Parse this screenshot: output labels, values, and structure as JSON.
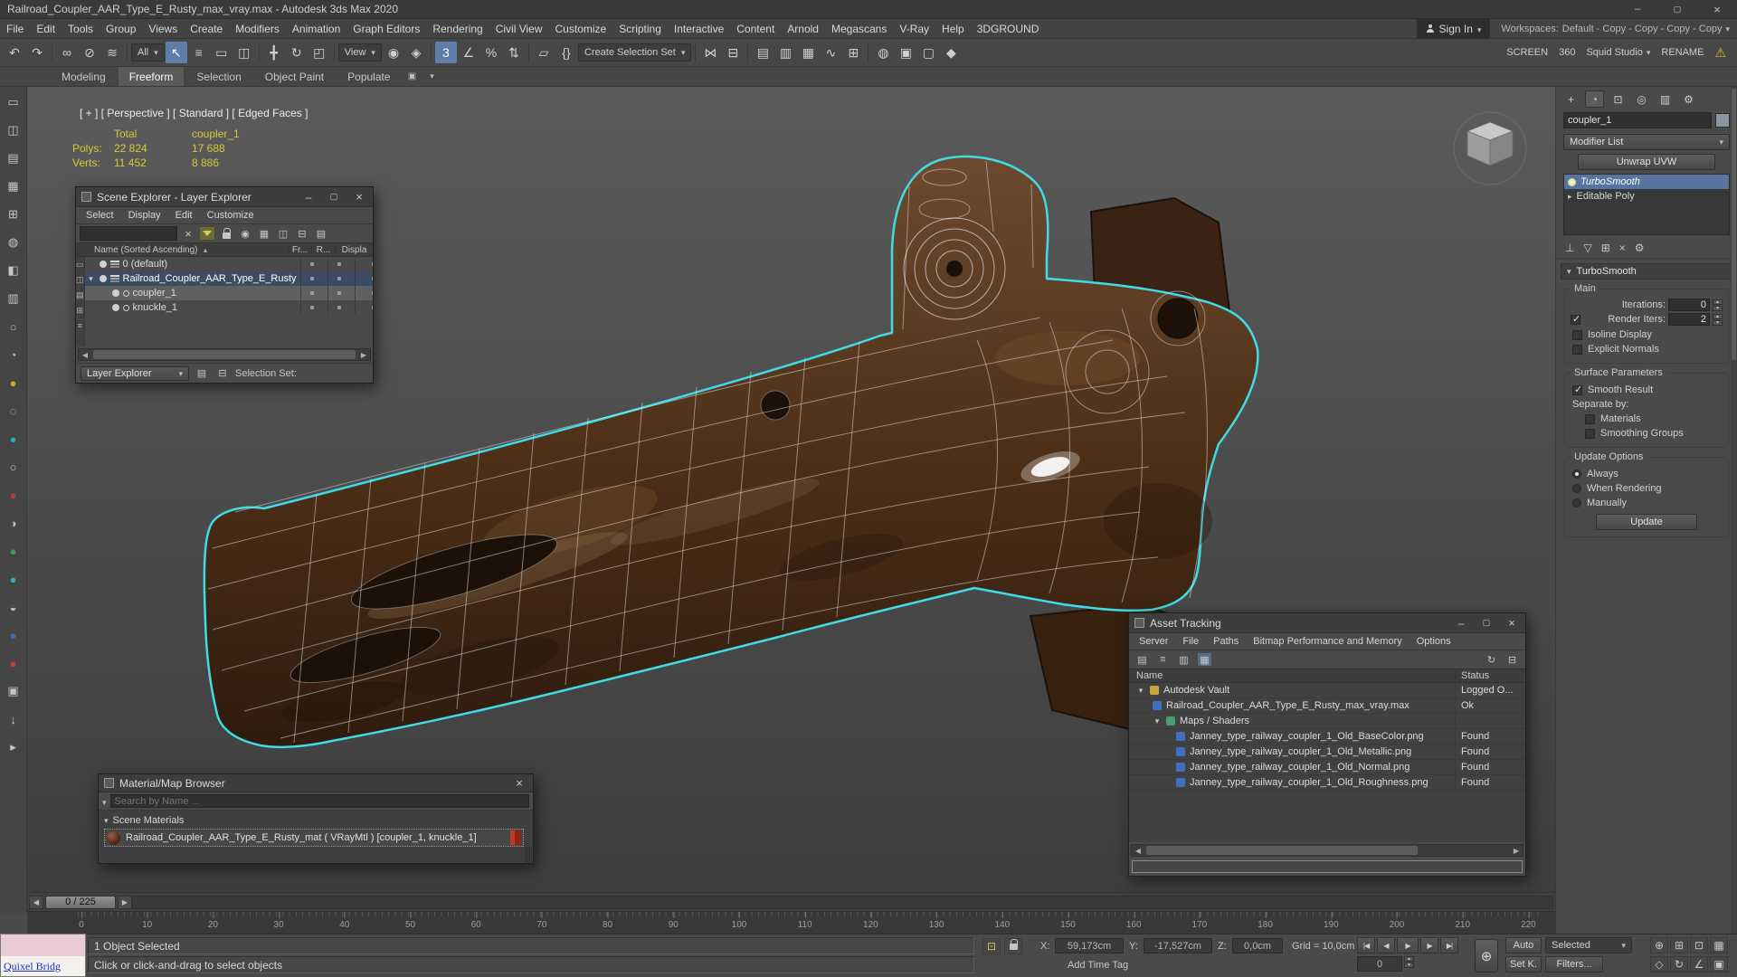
{
  "colors": {
    "selection_cyan": "#3fdce8",
    "highlight_blue": "#56749f",
    "stats_yellow": "#d6ca35",
    "warning_yellow": "#e0b52e"
  },
  "titlebar": {
    "title": "Railroad_Coupler_AAR_Type_E_Rusty_max_vray.max - Autodesk 3ds Max 2020"
  },
  "menubar": {
    "items": [
      "File",
      "Edit",
      "Tools",
      "Group",
      "Views",
      "Create",
      "Modifiers",
      "Animation",
      "Graph Editors",
      "Rendering",
      "Civil View",
      "Customize",
      "Scripting",
      "Interactive",
      "Content",
      "Arnold",
      "Megascans",
      "V-Ray",
      "Help",
      "3DGROUND"
    ],
    "sign_in": "Sign In",
    "workspaces_label": "Workspaces:",
    "workspaces_value": "Default - Copy - Copy - Copy - Copy"
  },
  "toolbar": {
    "filter_dropdown": "All",
    "view_dropdown": "View",
    "create_selection_set": "Create Selection Set",
    "screen_label": "SCREEN",
    "angle_value": "360",
    "studio_label": "Squid Studio",
    "rename_label": "RENAME",
    "icons": [
      {
        "name": "undo",
        "glyph": "↶"
      },
      {
        "name": "redo",
        "glyph": "↷"
      },
      {
        "name": "select-and-link",
        "glyph": "∞"
      },
      {
        "name": "unlink-selection",
        "glyph": "⊘"
      },
      {
        "name": "bind-to-space-warp",
        "glyph": "≋"
      },
      {
        "name": "select-object",
        "glyph": "↖"
      },
      {
        "name": "select-by-name",
        "glyph": "≡"
      },
      {
        "name": "rectangular-selection",
        "glyph": "▭"
      },
      {
        "name": "window-crossing",
        "glyph": "◫"
      },
      {
        "name": "select-and-move",
        "glyph": "╋"
      },
      {
        "name": "select-and-rotate",
        "glyph": "↻"
      },
      {
        "name": "select-and-scale",
        "glyph": "◰"
      },
      {
        "name": "use-pivot-center",
        "glyph": "◉"
      },
      {
        "name": "select-and-manipulate",
        "glyph": "◈"
      },
      {
        "name": "snaps-toggle",
        "glyph": "3"
      },
      {
        "name": "angle-snap",
        "glyph": "∠"
      },
      {
        "name": "percent-snap",
        "glyph": "%"
      },
      {
        "name": "spinner-snap",
        "glyph": "⇅"
      },
      {
        "name": "edit-named-selection-sets",
        "glyph": "▱"
      },
      {
        "name": "named-selection-sets",
        "glyph": "{}"
      },
      {
        "name": "mirror",
        "glyph": "⋈"
      },
      {
        "name": "align",
        "glyph": "⊟"
      },
      {
        "name": "toggle-scene-explorer",
        "glyph": "▤"
      },
      {
        "name": "toggle-layer-explorer",
        "glyph": "▥"
      },
      {
        "name": "toggle-ribbon",
        "glyph": "▦"
      },
      {
        "name": "curve-editor",
        "glyph": "∿"
      },
      {
        "name": "schematic-view",
        "glyph": "⊞"
      },
      {
        "name": "material-editor",
        "glyph": "◍"
      },
      {
        "name": "render-setup",
        "glyph": "▣"
      },
      {
        "name": "rendered-frame-window",
        "glyph": "▢"
      },
      {
        "name": "render-production",
        "glyph": "◆"
      }
    ]
  },
  "ribbon": {
    "tabs": [
      "Modeling",
      "Freeform",
      "Selection",
      "Object Paint",
      "Populate"
    ]
  },
  "left_toolbar": {
    "icons": [
      {
        "glyph": "▭",
        "color": "#c6c6c6"
      },
      {
        "glyph": "◫",
        "color": "#c6c6c6"
      },
      {
        "glyph": "▤",
        "color": "#c6c6c6"
      },
      {
        "glyph": "▦",
        "color": "#c6c6c6"
      },
      {
        "glyph": "⊞",
        "color": "#c6c6c6"
      },
      {
        "glyph": "◍",
        "color": "#c6c6c6"
      },
      {
        "glyph": "◧",
        "color": "#c6c6c6"
      },
      {
        "glyph": "▥",
        "color": "#c6c6c6"
      },
      {
        "glyph": "○",
        "color": "#c6c6c6"
      },
      {
        "glyph": "◔",
        "color": "#c6c6c6"
      },
      {
        "glyph": "●",
        "color": "#d2a82a"
      },
      {
        "glyph": "◌",
        "color": "#c6c6c6"
      },
      {
        "glyph": "●",
        "color": "#2fa9b5"
      },
      {
        "glyph": "○",
        "color": "#c6c6c6"
      },
      {
        "glyph": "●",
        "color": "#b4402e"
      },
      {
        "glyph": "◑",
        "color": "#c6c6c6"
      },
      {
        "glyph": "●",
        "color": "#3f9e4d"
      },
      {
        "glyph": "●",
        "color": "#35aeba"
      },
      {
        "glyph": "◒",
        "color": "#c6c6c6"
      },
      {
        "glyph": "●",
        "color": "#3e6cc2"
      },
      {
        "glyph": "●",
        "color": "#c23f33"
      },
      {
        "glyph": "▣",
        "color": "#c6c6c6"
      },
      {
        "glyph": "↓",
        "color": "#c6c6c6"
      },
      {
        "glyph": "▸",
        "color": "#c6c6c6"
      }
    ]
  },
  "viewport": {
    "label": "[ + ] [ Perspective ] [ Standard ] [ Edged Faces ]",
    "stats": {
      "col_total": "Total",
      "col_selected": "coupler_1",
      "polys_label": "Polys:",
      "polys_total": "22 824",
      "polys_selected": "17 688",
      "verts_label": "Verts:",
      "verts_total": "11 452",
      "verts_selected": "8 886"
    }
  },
  "scene_explorer": {
    "title": "Scene Explorer - Layer Explorer",
    "menus": [
      "Select",
      "Display",
      "Edit",
      "Customize"
    ],
    "name_column": "Name (Sorted Ascending)",
    "col_frozen": "Fr...",
    "col_render": "R...",
    "col_display": "Displa",
    "toolbar_icons": [
      "◉",
      "▦",
      "◫",
      "⊟",
      "▤"
    ],
    "rail_icons": [
      "▭",
      "◫",
      "▤",
      "⊞",
      "≡"
    ],
    "rows": [
      {
        "label": "0 (default)"
      },
      {
        "label": "Railroad_Coupler_AAR_Type_E_Rusty"
      },
      {
        "label": "coupler_1"
      },
      {
        "label": "knuckle_1"
      }
    ],
    "footer_dropdown": "Layer Explorer",
    "selection_set_label": "Selection Set:"
  },
  "material_browser": {
    "title": "Material/Map Browser",
    "search_placeholder": "Search by Name ...",
    "group_label": "Scene Materials",
    "material_label": "Railroad_Coupler_AAR_Type_E_Rusty_mat  ( VRayMtl )  [coupler_1, knuckle_1]"
  },
  "asset_tracking": {
    "title": "Asset Tracking",
    "menus": [
      "Server",
      "File",
      "Paths",
      "Bitmap Performance and Memory",
      "Options"
    ],
    "tool_icons": [
      "▤",
      "≡",
      "▥",
      "▦"
    ],
    "tool_icons_right": [
      "↻",
      "⊟"
    ],
    "col_name": "Name",
    "col_status": "Status",
    "rows": [
      {
        "name": "Autodesk Vault",
        "status": "Logged O..."
      },
      {
        "name": "Railroad_Coupler_AAR_Type_E_Rusty_max_vray.max",
        "status": "Ok"
      },
      {
        "name": "Maps / Shaders",
        "status": ""
      },
      {
        "name": "Janney_type_railway_coupler_1_Old_BaseColor.png",
        "status": "Found"
      },
      {
        "name": "Janney_type_railway_coupler_1_Old_Metallic.png",
        "status": "Found"
      },
      {
        "name": "Janney_type_railway_coupler_1_Old_Normal.png",
        "status": "Found"
      },
      {
        "name": "Janney_type_railway_coupler_1_Old_Roughness.png",
        "status": "Found"
      }
    ]
  },
  "command_panel": {
    "tabs": [
      {
        "name": "create",
        "glyph": "+"
      },
      {
        "name": "modify",
        "glyph": "◔"
      },
      {
        "name": "hierarchy",
        "glyph": "⊡"
      },
      {
        "name": "motion",
        "glyph": "◎"
      },
      {
        "name": "display",
        "glyph": "▥"
      },
      {
        "name": "utilities",
        "glyph": "⚙"
      }
    ],
    "object_name": "coupler_1",
    "modifier_list": "Modifier List",
    "unwrap_button": "Unwrap UVW",
    "stack": [
      {
        "label": "TurboSmooth"
      },
      {
        "label": "Editable Poly"
      }
    ],
    "stack_icons": [
      {
        "name": "pin-stack",
        "glyph": "⊥"
      },
      {
        "name": "show-end-result",
        "glyph": "▽"
      },
      {
        "name": "make-unique",
        "glyph": "⊞"
      },
      {
        "name": "remove-modifier",
        "glyph": "×"
      },
      {
        "name": "configure-modifier-sets",
        "glyph": "⚙"
      }
    ],
    "rollout_title": "TurboSmooth",
    "main_label": "Main",
    "iterations_label": "Iterations:",
    "iterations_value": "0",
    "render_iters_label": "Render Iters:",
    "render_iters_value": "2",
    "isoline_label": "Isoline Display",
    "explicit_label": "Explicit Normals",
    "surface_group": "Surface Parameters",
    "smooth_result_label": "Smooth Result",
    "separate_label": "Separate by:",
    "materials_label": "Materials",
    "smoothing_label": "Smoothing Groups",
    "update_group": "Update Options",
    "always_label": "Always",
    "when_rendering_label": "When Rendering",
    "manually_label": "Manually",
    "update_button": "Update"
  },
  "timeline": {
    "frame_label": "0 / 225",
    "ticks": [
      "0",
      "10",
      "20",
      "30",
      "40",
      "50",
      "60",
      "70",
      "80",
      "90",
      "100",
      "110",
      "120",
      "130",
      "140",
      "150",
      "160",
      "170",
      "180",
      "190",
      "200",
      "210",
      "220"
    ]
  },
  "statusbar": {
    "selection_status": "1 Object Selected",
    "prompt": "Click or click-and-drag to select objects",
    "x_label": "X:",
    "x_value": "59,173cm",
    "y_label": "Y:",
    "y_value": "-17,527cm",
    "z_label": "Z:",
    "z_value": "0,0cm",
    "grid_label": "Grid = 10,0cm",
    "add_time_tag": "Add Time Tag",
    "frame_field": "0",
    "auto_button": "Auto",
    "selected_dropdown": "Selected",
    "set_key_button": "Set K.",
    "filters_button": "Filters...",
    "quixel_title": "Quixel Bridg",
    "transport": [
      {
        "name": "go-to-start",
        "glyph": "|◀"
      },
      {
        "name": "previous-frame",
        "glyph": "◀"
      },
      {
        "name": "play",
        "glyph": "▶"
      },
      {
        "name": "next-frame",
        "glyph": "▶"
      },
      {
        "name": "go-to-end",
        "glyph": "▶|"
      }
    ],
    "nav": [
      {
        "name": "zoom",
        "glyph": "⊕"
      },
      {
        "name": "zoom-all",
        "glyph": "⊞"
      },
      {
        "name": "zoom-extents",
        "glyph": "⊡"
      },
      {
        "name": "zoom-extents-all",
        "glyph": "▦"
      },
      {
        "name": "pan",
        "glyph": "◇"
      },
      {
        "name": "orbit",
        "glyph": "↻"
      },
      {
        "name": "field-of-view",
        "glyph": "∠"
      },
      {
        "name": "maximize-viewport",
        "glyph": "▣"
      }
    ]
  }
}
